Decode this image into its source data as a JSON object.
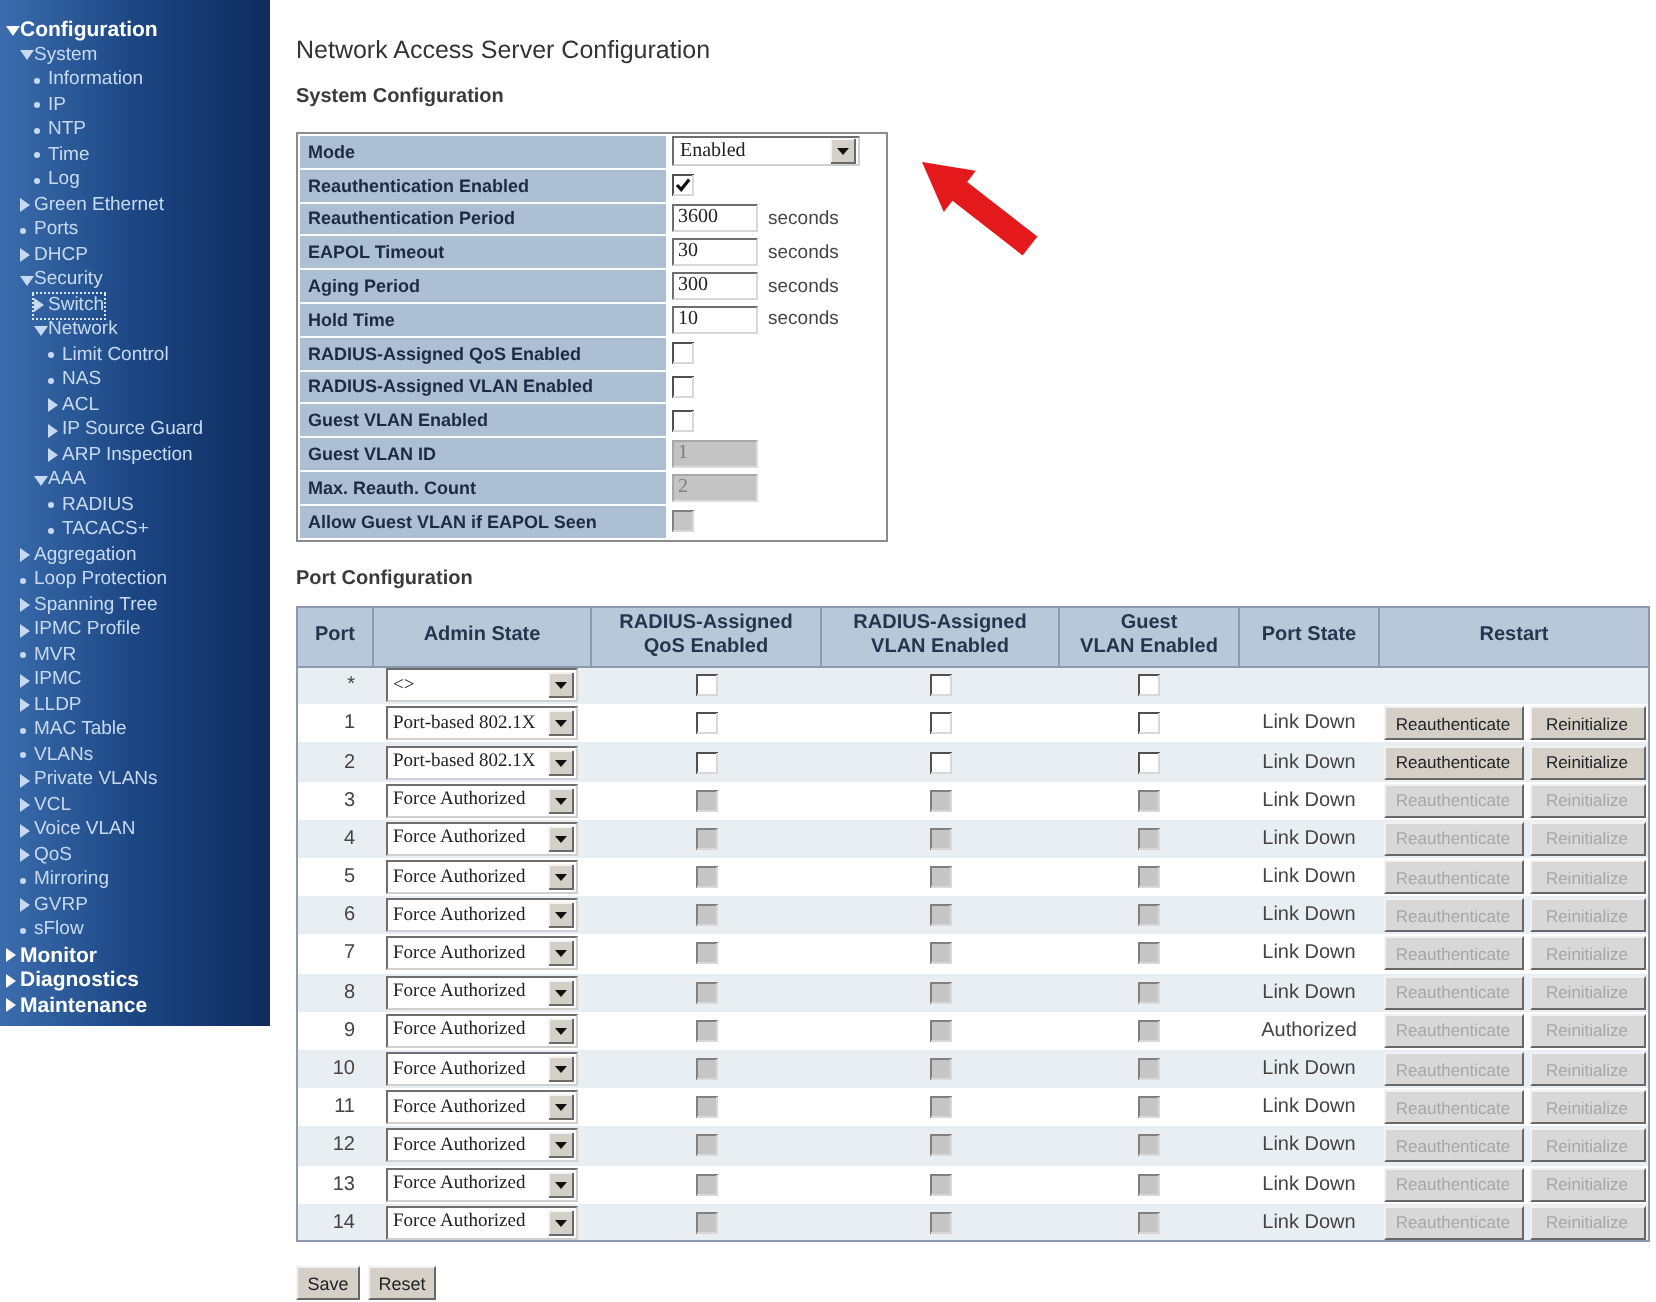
{
  "sidebar": {
    "items": [
      {
        "label": "Configuration",
        "kind": "folder",
        "expanded": true,
        "children": [
          {
            "label": "System",
            "kind": "folder",
            "expanded": true,
            "children": [
              {
                "label": "Information",
                "kind": "page"
              },
              {
                "label": "IP",
                "kind": "page"
              },
              {
                "label": "NTP",
                "kind": "page"
              },
              {
                "label": "Time",
                "kind": "page"
              },
              {
                "label": "Log",
                "kind": "page"
              }
            ]
          },
          {
            "label": "Green Ethernet",
            "kind": "folder",
            "expanded": false
          },
          {
            "label": "Ports",
            "kind": "page"
          },
          {
            "label": "DHCP",
            "kind": "folder",
            "expanded": false
          },
          {
            "label": "Security",
            "kind": "folder",
            "expanded": true,
            "children": [
              {
                "label": "Switch",
                "kind": "folder",
                "expanded": false,
                "focused": true
              },
              {
                "label": "Network",
                "kind": "folder",
                "expanded": true,
                "children": [
                  {
                    "label": "Limit Control",
                    "kind": "page"
                  },
                  {
                    "label": "NAS",
                    "kind": "page"
                  },
                  {
                    "label": "ACL",
                    "kind": "folder",
                    "expanded": false
                  },
                  {
                    "label": "IP Source Guard",
                    "kind": "folder",
                    "expanded": false
                  },
                  {
                    "label": "ARP Inspection",
                    "kind": "folder",
                    "expanded": false
                  }
                ]
              },
              {
                "label": "AAA",
                "kind": "folder",
                "expanded": true,
                "children": [
                  {
                    "label": "RADIUS",
                    "kind": "page"
                  },
                  {
                    "label": "TACACS+",
                    "kind": "page"
                  }
                ]
              }
            ]
          },
          {
            "label": "Aggregation",
            "kind": "folder",
            "expanded": false
          },
          {
            "label": "Loop Protection",
            "kind": "page"
          },
          {
            "label": "Spanning Tree",
            "kind": "folder",
            "expanded": false
          },
          {
            "label": "IPMC Profile",
            "kind": "folder",
            "expanded": false
          },
          {
            "label": "MVR",
            "kind": "page"
          },
          {
            "label": "IPMC",
            "kind": "folder",
            "expanded": false
          },
          {
            "label": "LLDP",
            "kind": "folder",
            "expanded": false
          },
          {
            "label": "MAC Table",
            "kind": "page"
          },
          {
            "label": "VLANs",
            "kind": "page"
          },
          {
            "label": "Private VLANs",
            "kind": "folder",
            "expanded": false
          },
          {
            "label": "VCL",
            "kind": "folder",
            "expanded": false
          },
          {
            "label": "Voice VLAN",
            "kind": "folder",
            "expanded": false
          },
          {
            "label": "QoS",
            "kind": "folder",
            "expanded": false
          },
          {
            "label": "Mirroring",
            "kind": "page"
          },
          {
            "label": "GVRP",
            "kind": "folder",
            "expanded": false
          },
          {
            "label": "sFlow",
            "kind": "page"
          }
        ]
      },
      {
        "label": "Monitor",
        "kind": "folder",
        "expanded": false
      },
      {
        "label": "Diagnostics",
        "kind": "folder",
        "expanded": false
      },
      {
        "label": "Maintenance",
        "kind": "folder",
        "expanded": false
      }
    ]
  },
  "page": {
    "title": "Network Access Server Configuration"
  },
  "system_config": {
    "heading": "System Configuration",
    "rows": [
      {
        "label": "Mode",
        "kind": "select",
        "value": "Enabled",
        "disabled": false
      },
      {
        "label": "Reauthentication Enabled",
        "kind": "checkbox",
        "checked": true,
        "disabled": false
      },
      {
        "label": "Reauthentication Period",
        "kind": "number",
        "value": "3600",
        "unit": "seconds",
        "disabled": false
      },
      {
        "label": "EAPOL Timeout",
        "kind": "number",
        "value": "30",
        "unit": "seconds",
        "disabled": false
      },
      {
        "label": "Aging Period",
        "kind": "number",
        "value": "300",
        "unit": "seconds",
        "disabled": false
      },
      {
        "label": "Hold Time",
        "kind": "number",
        "value": "10",
        "unit": "seconds",
        "disabled": false
      },
      {
        "label": "RADIUS-Assigned QoS Enabled",
        "kind": "checkbox",
        "checked": false,
        "disabled": false
      },
      {
        "label": "RADIUS-Assigned VLAN Enabled",
        "kind": "checkbox",
        "checked": false,
        "disabled": false
      },
      {
        "label": "Guest VLAN Enabled",
        "kind": "checkbox",
        "checked": false,
        "disabled": false
      },
      {
        "label": "Guest VLAN ID",
        "kind": "number",
        "value": "1",
        "disabled": true
      },
      {
        "label": "Max. Reauth. Count",
        "kind": "number",
        "value": "2",
        "disabled": true
      },
      {
        "label": "Allow Guest VLAN if EAPOL Seen",
        "kind": "checkbox",
        "checked": false,
        "disabled": true
      }
    ]
  },
  "port_config": {
    "heading": "Port Configuration",
    "columns": [
      "Port",
      "Admin State",
      "RADIUS-Assigned\nQoS Enabled",
      "RADIUS-Assigned\nVLAN Enabled",
      "Guest\nVLAN Enabled",
      "Port State",
      "Restart"
    ],
    "rows": [
      {
        "port": "*",
        "admin_state": "<>",
        "options": [
          {
            "checked": false,
            "disabled": false
          },
          {
            "checked": false,
            "disabled": false
          },
          {
            "checked": false,
            "disabled": false
          }
        ]
      },
      {
        "port": "1",
        "admin_state": "Port-based 802.1X",
        "options": [
          {
            "checked": false,
            "disabled": false
          },
          {
            "checked": false,
            "disabled": false
          },
          {
            "checked": false,
            "disabled": false
          }
        ],
        "port_state": "Link Down",
        "buttons": [
          {
            "label": "Reauthenticate",
            "disabled": false
          },
          {
            "label": "Reinitialize",
            "disabled": false
          }
        ]
      },
      {
        "port": "2",
        "admin_state": "Port-based 802.1X",
        "options": [
          {
            "checked": false,
            "disabled": false
          },
          {
            "checked": false,
            "disabled": false
          },
          {
            "checked": false,
            "disabled": false
          }
        ],
        "port_state": "Link Down",
        "buttons": [
          {
            "label": "Reauthenticate",
            "disabled": false
          },
          {
            "label": "Reinitialize",
            "disabled": false
          }
        ]
      },
      {
        "port": "3",
        "admin_state": "Force Authorized",
        "options": [
          {
            "checked": false,
            "disabled": true
          },
          {
            "checked": false,
            "disabled": true
          },
          {
            "checked": false,
            "disabled": true
          }
        ],
        "port_state": "Link Down",
        "buttons": [
          {
            "label": "Reauthenticate",
            "disabled": true
          },
          {
            "label": "Reinitialize",
            "disabled": true
          }
        ]
      },
      {
        "port": "4",
        "admin_state": "Force Authorized",
        "options": [
          {
            "checked": false,
            "disabled": true
          },
          {
            "checked": false,
            "disabled": true
          },
          {
            "checked": false,
            "disabled": true
          }
        ],
        "port_state": "Link Down",
        "buttons": [
          {
            "label": "Reauthenticate",
            "disabled": true
          },
          {
            "label": "Reinitialize",
            "disabled": true
          }
        ]
      },
      {
        "port": "5",
        "admin_state": "Force Authorized",
        "options": [
          {
            "checked": false,
            "disabled": true
          },
          {
            "checked": false,
            "disabled": true
          },
          {
            "checked": false,
            "disabled": true
          }
        ],
        "port_state": "Link Down",
        "buttons": [
          {
            "label": "Reauthenticate",
            "disabled": true
          },
          {
            "label": "Reinitialize",
            "disabled": true
          }
        ]
      },
      {
        "port": "6",
        "admin_state": "Force Authorized",
        "options": [
          {
            "checked": false,
            "disabled": true
          },
          {
            "checked": false,
            "disabled": true
          },
          {
            "checked": false,
            "disabled": true
          }
        ],
        "port_state": "Link Down",
        "buttons": [
          {
            "label": "Reauthenticate",
            "disabled": true
          },
          {
            "label": "Reinitialize",
            "disabled": true
          }
        ]
      },
      {
        "port": "7",
        "admin_state": "Force Authorized",
        "options": [
          {
            "checked": false,
            "disabled": true
          },
          {
            "checked": false,
            "disabled": true
          },
          {
            "checked": false,
            "disabled": true
          }
        ],
        "port_state": "Link Down",
        "buttons": [
          {
            "label": "Reauthenticate",
            "disabled": true
          },
          {
            "label": "Reinitialize",
            "disabled": true
          }
        ]
      },
      {
        "port": "8",
        "admin_state": "Force Authorized",
        "options": [
          {
            "checked": false,
            "disabled": true
          },
          {
            "checked": false,
            "disabled": true
          },
          {
            "checked": false,
            "disabled": true
          }
        ],
        "port_state": "Link Down",
        "buttons": [
          {
            "label": "Reauthenticate",
            "disabled": true
          },
          {
            "label": "Reinitialize",
            "disabled": true
          }
        ]
      },
      {
        "port": "9",
        "admin_state": "Force Authorized",
        "options": [
          {
            "checked": false,
            "disabled": true
          },
          {
            "checked": false,
            "disabled": true
          },
          {
            "checked": false,
            "disabled": true
          }
        ],
        "port_state": "Authorized",
        "buttons": [
          {
            "label": "Reauthenticate",
            "disabled": true
          },
          {
            "label": "Reinitialize",
            "disabled": true
          }
        ]
      },
      {
        "port": "10",
        "admin_state": "Force Authorized",
        "options": [
          {
            "checked": false,
            "disabled": true
          },
          {
            "checked": false,
            "disabled": true
          },
          {
            "checked": false,
            "disabled": true
          }
        ],
        "port_state": "Link Down",
        "buttons": [
          {
            "label": "Reauthenticate",
            "disabled": true
          },
          {
            "label": "Reinitialize",
            "disabled": true
          }
        ]
      },
      {
        "port": "11",
        "admin_state": "Force Authorized",
        "options": [
          {
            "checked": false,
            "disabled": true
          },
          {
            "checked": false,
            "disabled": true
          },
          {
            "checked": false,
            "disabled": true
          }
        ],
        "port_state": "Link Down",
        "buttons": [
          {
            "label": "Reauthenticate",
            "disabled": true
          },
          {
            "label": "Reinitialize",
            "disabled": true
          }
        ]
      },
      {
        "port": "12",
        "admin_state": "Force Authorized",
        "options": [
          {
            "checked": false,
            "disabled": true
          },
          {
            "checked": false,
            "disabled": true
          },
          {
            "checked": false,
            "disabled": true
          }
        ],
        "port_state": "Link Down",
        "buttons": [
          {
            "label": "Reauthenticate",
            "disabled": true
          },
          {
            "label": "Reinitialize",
            "disabled": true
          }
        ]
      },
      {
        "port": "13",
        "admin_state": "Force Authorized",
        "options": [
          {
            "checked": false,
            "disabled": true
          },
          {
            "checked": false,
            "disabled": true
          },
          {
            "checked": false,
            "disabled": true
          }
        ],
        "port_state": "Link Down",
        "buttons": [
          {
            "label": "Reauthenticate",
            "disabled": true
          },
          {
            "label": "Reinitialize",
            "disabled": true
          }
        ]
      },
      {
        "port": "14",
        "admin_state": "Force Authorized",
        "options": [
          {
            "checked": false,
            "disabled": true
          },
          {
            "checked": false,
            "disabled": true
          },
          {
            "checked": false,
            "disabled": true
          }
        ],
        "port_state": "Link Down",
        "buttons": [
          {
            "label": "Reauthenticate",
            "disabled": true
          },
          {
            "label": "Reinitialize",
            "disabled": true
          }
        ]
      }
    ]
  },
  "buttons": [
    {
      "label": "Save"
    },
    {
      "label": "Reset"
    }
  ],
  "annotations": [
    {
      "kind": "arrow"
    }
  ]
}
